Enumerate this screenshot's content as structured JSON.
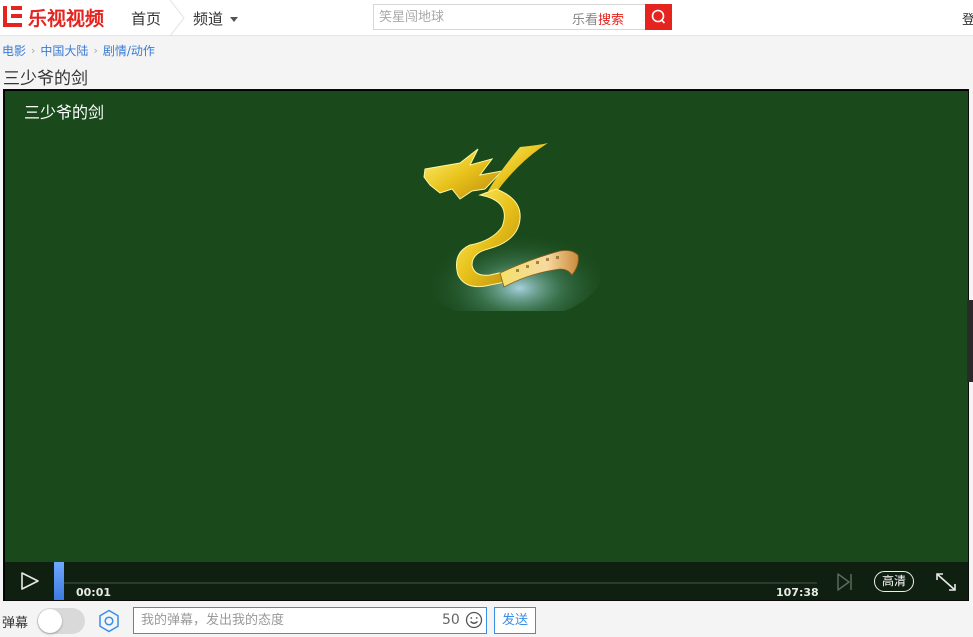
{
  "header": {
    "logo_text": "乐视视频",
    "nav_home": "首页",
    "nav_channel": "频道",
    "search": {
      "placeholder": "笑星闯地球",
      "hint_prefix": "乐看",
      "hint_suffix": "搜索"
    },
    "login_label": "登"
  },
  "breadcrumb": {
    "items": [
      "电影",
      "中国大陆",
      "剧情/动作"
    ]
  },
  "page_title": "三少爷的剑",
  "player": {
    "video_title": "三少爷的剑",
    "current_time": "00:01",
    "total_time": "107:38",
    "progress": 0.0002,
    "quality_label": "高清"
  },
  "danmu": {
    "label": "弹幕",
    "enabled": false,
    "input_placeholder": "我的弹幕，发出我的态度",
    "char_count": "50",
    "send_label": "发送"
  },
  "colors": {
    "brand_red": "#e5241f",
    "video_bg": "#1a4a1c",
    "link_blue": "#3a7bd5",
    "accent_blue": "#3a8ee6"
  }
}
